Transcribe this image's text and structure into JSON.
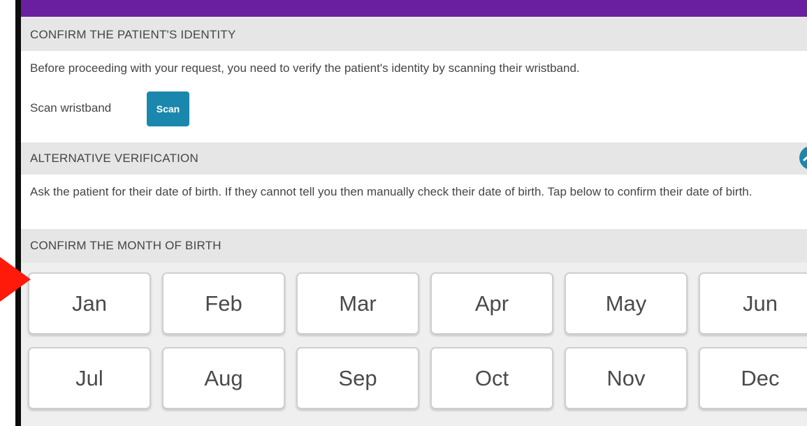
{
  "sections": {
    "identity": {
      "header": "CONFIRM THE PATIENT'S IDENTITY",
      "description": "Before proceeding with your request, you need to verify the patient's identity by scanning their wristband.",
      "scan_label": "Scan wristband",
      "scan_button": "Scan"
    },
    "alternative": {
      "header": "ALTERNATIVE VERIFICATION",
      "description": "Ask the patient for their date of birth. If they cannot tell you then manually check their date of birth. Tap below to confirm their date of birth.",
      "toggle_icon": "chevron-up-icon"
    },
    "month": {
      "header": "CONFIRM THE MONTH OF BIRTH",
      "months": [
        "Jan",
        "Feb",
        "Mar",
        "Apr",
        "May",
        "Jun",
        "Jul",
        "Aug",
        "Sep",
        "Oct",
        "Nov",
        "Dec"
      ]
    }
  },
  "colors": {
    "top_bar": "#5f1b92",
    "accent": "#1b87ad",
    "header_bg": "#e6e6e6",
    "pointer": "#ff1a0a"
  }
}
